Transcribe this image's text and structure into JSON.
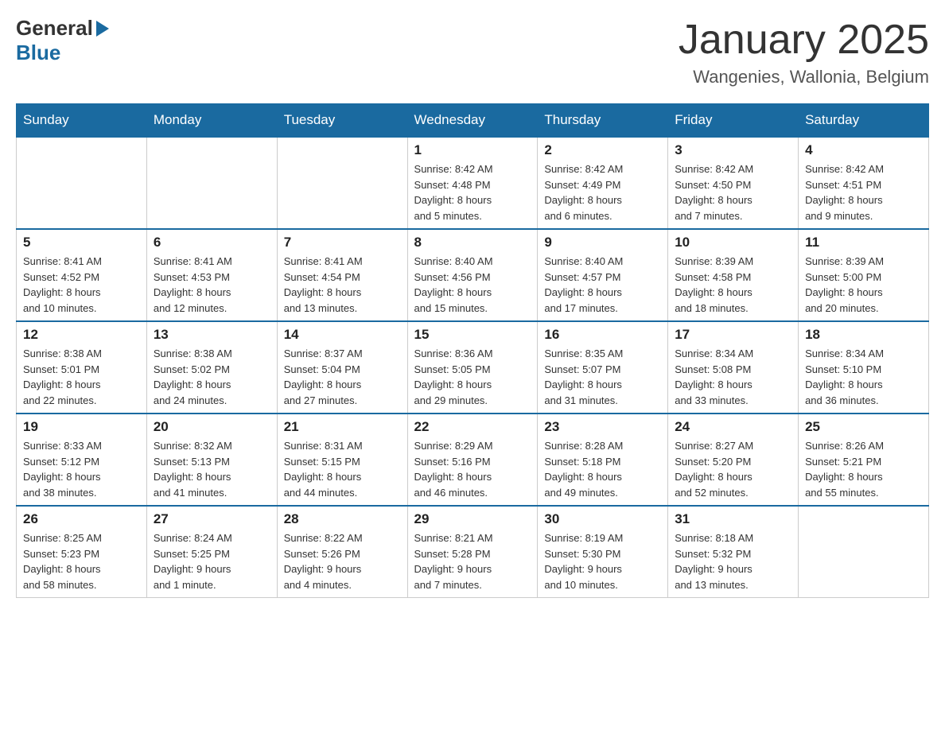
{
  "logo": {
    "general": "General",
    "blue": "Blue"
  },
  "title": "January 2025",
  "location": "Wangenies, Wallonia, Belgium",
  "days_of_week": [
    "Sunday",
    "Monday",
    "Tuesday",
    "Wednesday",
    "Thursday",
    "Friday",
    "Saturday"
  ],
  "weeks": [
    [
      {
        "day": "",
        "info": ""
      },
      {
        "day": "",
        "info": ""
      },
      {
        "day": "",
        "info": ""
      },
      {
        "day": "1",
        "info": "Sunrise: 8:42 AM\nSunset: 4:48 PM\nDaylight: 8 hours\nand 5 minutes."
      },
      {
        "day": "2",
        "info": "Sunrise: 8:42 AM\nSunset: 4:49 PM\nDaylight: 8 hours\nand 6 minutes."
      },
      {
        "day": "3",
        "info": "Sunrise: 8:42 AM\nSunset: 4:50 PM\nDaylight: 8 hours\nand 7 minutes."
      },
      {
        "day": "4",
        "info": "Sunrise: 8:42 AM\nSunset: 4:51 PM\nDaylight: 8 hours\nand 9 minutes."
      }
    ],
    [
      {
        "day": "5",
        "info": "Sunrise: 8:41 AM\nSunset: 4:52 PM\nDaylight: 8 hours\nand 10 minutes."
      },
      {
        "day": "6",
        "info": "Sunrise: 8:41 AM\nSunset: 4:53 PM\nDaylight: 8 hours\nand 12 minutes."
      },
      {
        "day": "7",
        "info": "Sunrise: 8:41 AM\nSunset: 4:54 PM\nDaylight: 8 hours\nand 13 minutes."
      },
      {
        "day": "8",
        "info": "Sunrise: 8:40 AM\nSunset: 4:56 PM\nDaylight: 8 hours\nand 15 minutes."
      },
      {
        "day": "9",
        "info": "Sunrise: 8:40 AM\nSunset: 4:57 PM\nDaylight: 8 hours\nand 17 minutes."
      },
      {
        "day": "10",
        "info": "Sunrise: 8:39 AM\nSunset: 4:58 PM\nDaylight: 8 hours\nand 18 minutes."
      },
      {
        "day": "11",
        "info": "Sunrise: 8:39 AM\nSunset: 5:00 PM\nDaylight: 8 hours\nand 20 minutes."
      }
    ],
    [
      {
        "day": "12",
        "info": "Sunrise: 8:38 AM\nSunset: 5:01 PM\nDaylight: 8 hours\nand 22 minutes."
      },
      {
        "day": "13",
        "info": "Sunrise: 8:38 AM\nSunset: 5:02 PM\nDaylight: 8 hours\nand 24 minutes."
      },
      {
        "day": "14",
        "info": "Sunrise: 8:37 AM\nSunset: 5:04 PM\nDaylight: 8 hours\nand 27 minutes."
      },
      {
        "day": "15",
        "info": "Sunrise: 8:36 AM\nSunset: 5:05 PM\nDaylight: 8 hours\nand 29 minutes."
      },
      {
        "day": "16",
        "info": "Sunrise: 8:35 AM\nSunset: 5:07 PM\nDaylight: 8 hours\nand 31 minutes."
      },
      {
        "day": "17",
        "info": "Sunrise: 8:34 AM\nSunset: 5:08 PM\nDaylight: 8 hours\nand 33 minutes."
      },
      {
        "day": "18",
        "info": "Sunrise: 8:34 AM\nSunset: 5:10 PM\nDaylight: 8 hours\nand 36 minutes."
      }
    ],
    [
      {
        "day": "19",
        "info": "Sunrise: 8:33 AM\nSunset: 5:12 PM\nDaylight: 8 hours\nand 38 minutes."
      },
      {
        "day": "20",
        "info": "Sunrise: 8:32 AM\nSunset: 5:13 PM\nDaylight: 8 hours\nand 41 minutes."
      },
      {
        "day": "21",
        "info": "Sunrise: 8:31 AM\nSunset: 5:15 PM\nDaylight: 8 hours\nand 44 minutes."
      },
      {
        "day": "22",
        "info": "Sunrise: 8:29 AM\nSunset: 5:16 PM\nDaylight: 8 hours\nand 46 minutes."
      },
      {
        "day": "23",
        "info": "Sunrise: 8:28 AM\nSunset: 5:18 PM\nDaylight: 8 hours\nand 49 minutes."
      },
      {
        "day": "24",
        "info": "Sunrise: 8:27 AM\nSunset: 5:20 PM\nDaylight: 8 hours\nand 52 minutes."
      },
      {
        "day": "25",
        "info": "Sunrise: 8:26 AM\nSunset: 5:21 PM\nDaylight: 8 hours\nand 55 minutes."
      }
    ],
    [
      {
        "day": "26",
        "info": "Sunrise: 8:25 AM\nSunset: 5:23 PM\nDaylight: 8 hours\nand 58 minutes."
      },
      {
        "day": "27",
        "info": "Sunrise: 8:24 AM\nSunset: 5:25 PM\nDaylight: 9 hours\nand 1 minute."
      },
      {
        "day": "28",
        "info": "Sunrise: 8:22 AM\nSunset: 5:26 PM\nDaylight: 9 hours\nand 4 minutes."
      },
      {
        "day": "29",
        "info": "Sunrise: 8:21 AM\nSunset: 5:28 PM\nDaylight: 9 hours\nand 7 minutes."
      },
      {
        "day": "30",
        "info": "Sunrise: 8:19 AM\nSunset: 5:30 PM\nDaylight: 9 hours\nand 10 minutes."
      },
      {
        "day": "31",
        "info": "Sunrise: 8:18 AM\nSunset: 5:32 PM\nDaylight: 9 hours\nand 13 minutes."
      },
      {
        "day": "",
        "info": ""
      }
    ]
  ]
}
